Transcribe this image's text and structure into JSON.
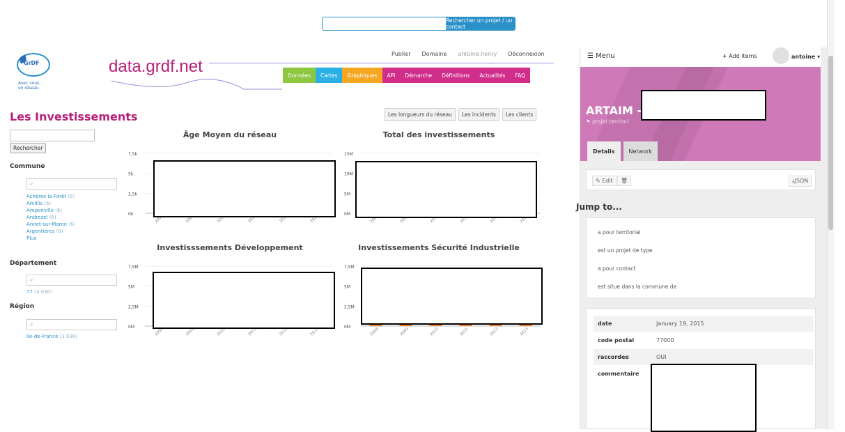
{
  "top_search": {
    "button_label": "Rechercher un projet / un contact"
  },
  "logo": {
    "brand": "GrDF",
    "tagline_1": "Avec vous,",
    "tagline_2": "en réseau"
  },
  "site_title": "data.grdf.net",
  "header_links": [
    "Publier",
    "Domaine",
    "antoine.henry",
    "Déconnexion"
  ],
  "nav_tabs": [
    "Données",
    "Cartes",
    "Graphiques",
    "API",
    "Démarche",
    "Définitions",
    "Actualités",
    "FAQ"
  ],
  "page_title": "Les Investissements",
  "right_tabs": [
    "Les longueurs du réseau",
    "Les incidents",
    "Les clients"
  ],
  "sidebar": {
    "search_button": "Rechercher",
    "commune": {
      "title": "Commune",
      "search_icon": "search-icon",
      "items": [
        {
          "label": "Achères-la-Forêt",
          "count": "(6)"
        },
        {
          "label": "Amillis",
          "count": "(6)"
        },
        {
          "label": "Amponville",
          "count": "(6)"
        },
        {
          "label": "Andrezel",
          "count": "(6)"
        },
        {
          "label": "Annet-sur-Marne",
          "count": "(6)"
        },
        {
          "label": "Argentières",
          "count": "(6)"
        }
      ],
      "more": "Plus"
    },
    "departement": {
      "title": "Département",
      "items": [
        {
          "label": "77",
          "count": "(3 036)"
        }
      ]
    },
    "region": {
      "title": "Région",
      "items": [
        {
          "label": "Ile-de-France",
          "count": "(3 036)"
        }
      ]
    }
  },
  "chart_data": [
    {
      "type": "bar",
      "title": "Âge Moyen du réseau",
      "categories": [
        "2008",
        "2009",
        "2010",
        "2011",
        "2012",
        "2013"
      ],
      "yticks": [
        "7,5k",
        "5k",
        "2,5k",
        "0k"
      ],
      "ylim": [
        0,
        7500
      ]
    },
    {
      "type": "bar",
      "title": "Total des investissements",
      "categories": [
        "2008",
        "2009",
        "2010",
        "2011",
        "2012",
        "2013"
      ],
      "yticks": [
        "15M",
        "10M",
        "5M",
        "0M"
      ],
      "ylim": [
        0,
        15000000
      ]
    },
    {
      "type": "bar",
      "title": "Investisssements Développement",
      "categories": [
        "2008",
        "2009",
        "2010",
        "2011",
        "2012",
        "2013"
      ],
      "yticks": [
        "7,5M",
        "5M",
        "2,5M",
        "0M"
      ],
      "ylim": [
        0,
        7500000
      ]
    },
    {
      "type": "bar",
      "title": "Investissements Sécurité Industrielle",
      "categories": [
        "2008",
        "2009",
        "2010",
        "2011",
        "2012",
        "2013"
      ],
      "yticks": [
        "7,5M",
        "5M",
        "2,5M",
        "0M"
      ],
      "ylim": [
        0,
        7500000
      ]
    }
  ],
  "panel": {
    "menu_label": "Menu",
    "add_items": "Add items",
    "username": "antoine",
    "entity_title": "ARTAIM -",
    "entity_type": "projet territori",
    "tabs": [
      "Details",
      "Network"
    ],
    "edit_label": "Edit",
    "json_label": "JSON",
    "jump_title": "Jump to...",
    "jump_links": [
      "a pour territorial",
      "est un projet de type",
      "a pour contact",
      "est situe dans la commune de"
    ],
    "properties": [
      {
        "key": "date",
        "value": "January 19, 2015"
      },
      {
        "key": "code postal",
        "value": "77000"
      },
      {
        "key": "raccordee",
        "value": "OUI"
      },
      {
        "key": "commentaire",
        "value": ""
      }
    ]
  },
  "colors": {
    "brand_pink": "#b6217a",
    "brand_blue": "#2a90c8",
    "bar_orange": "#f07c22"
  }
}
